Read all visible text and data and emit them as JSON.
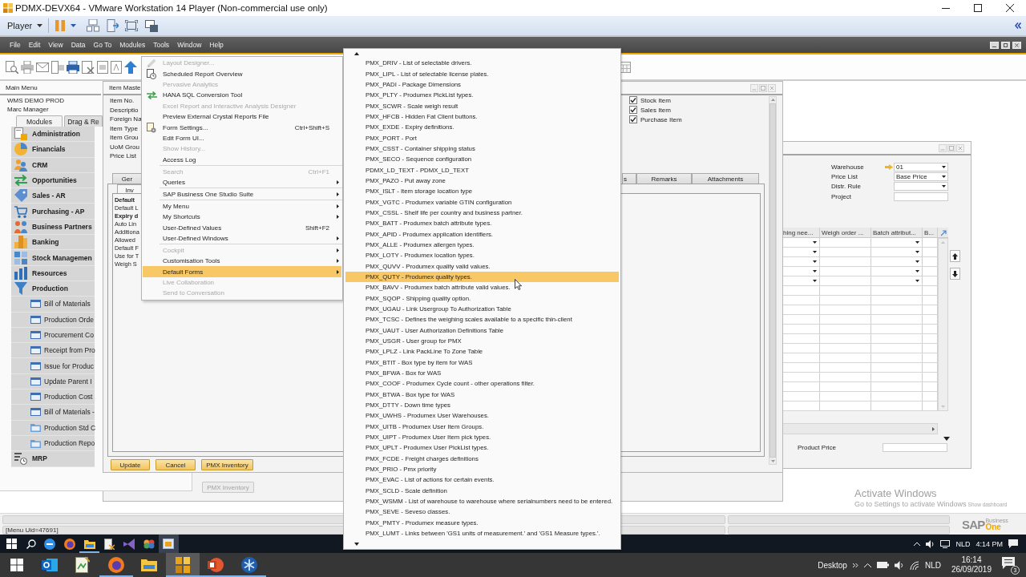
{
  "vm_window": {
    "title": "PDMX-DEVX64 - VMware Workstation 14 Player (Non-commercial use only)",
    "player_menu": "Player"
  },
  "menu_bar": [
    "File",
    "Edit",
    "View",
    "Data",
    "Go To",
    "Modules",
    "Tools",
    "Window",
    "Help"
  ],
  "tools_menu": {
    "groups": [
      [
        {
          "label": "Layout Designer...",
          "disabled": true,
          "submenu": false,
          "selected": false
        },
        {
          "label": "Scheduled Report Overview",
          "disabled": false,
          "submenu": false,
          "selected": false
        },
        {
          "label": "Pervasive Analytics",
          "disabled": true,
          "submenu": false,
          "selected": false
        },
        {
          "label": "HANA SQL Conversion Tool",
          "disabled": false,
          "submenu": false,
          "selected": false
        },
        {
          "label": "Excel Report and Interactive Analysis Designer",
          "disabled": true,
          "submenu": false,
          "selected": false
        },
        {
          "label": "Preview External Crystal Reports File",
          "disabled": false,
          "submenu": false,
          "selected": false
        },
        {
          "label": "Form Settings...",
          "shortcut": "Ctrl+Shift+S",
          "disabled": false,
          "submenu": false,
          "selected": false
        },
        {
          "label": "Edit Form UI...",
          "disabled": false,
          "submenu": false,
          "selected": false
        },
        {
          "label": "Show History...",
          "disabled": true,
          "submenu": false,
          "selected": false
        },
        {
          "label": "Access Log",
          "disabled": false,
          "submenu": false,
          "selected": false
        }
      ],
      [
        {
          "label": "Search",
          "shortcut": "Ctrl+F1",
          "disabled": true,
          "submenu": false,
          "selected": false
        },
        {
          "label": "Queries",
          "disabled": false,
          "submenu": true,
          "selected": false
        }
      ],
      [
        {
          "label": "SAP Business One Studio Suite",
          "disabled": false,
          "submenu": true,
          "selected": false
        }
      ],
      [
        {
          "label": "My Menu",
          "disabled": false,
          "submenu": true,
          "selected": false
        },
        {
          "label": "My Shortcuts",
          "disabled": false,
          "submenu": true,
          "selected": false
        },
        {
          "label": "User-Defined Values",
          "shortcut": "Shift+F2",
          "disabled": false,
          "submenu": false,
          "selected": false
        },
        {
          "label": "User-Defined Windows",
          "disabled": false,
          "submenu": true,
          "selected": false
        }
      ],
      [
        {
          "label": "Cockpit",
          "disabled": true,
          "submenu": true,
          "selected": false
        },
        {
          "label": "Customisation Tools",
          "disabled": false,
          "submenu": true,
          "selected": false
        },
        {
          "label": "Default Forms",
          "disabled": false,
          "submenu": true,
          "selected": true
        },
        {
          "label": "Live Collaboration",
          "disabled": true,
          "submenu": false,
          "selected": false
        },
        {
          "label": "Send to Conversation",
          "disabled": true,
          "submenu": false,
          "selected": false
        }
      ]
    ]
  },
  "default_forms_menu": {
    "items": [
      {
        "label": "PMX_DRIV - List of selectable drivers.",
        "selected": false
      },
      {
        "label": "PMX_LIPL - List of selectable license plates.",
        "selected": false
      },
      {
        "label": "PMX_PADI - Package Dimensions",
        "selected": false
      },
      {
        "label": "PMX_PLTY - Produmex PickList types.",
        "selected": false
      },
      {
        "label": "PMX_SCWR - Scale weigh result",
        "selected": false
      },
      {
        "label": "PMX_HFCB - Hidden Fat Client buttons.",
        "selected": false
      },
      {
        "label": "PMX_EXDE - Expiry definitions.",
        "selected": false
      },
      {
        "label": "PMX_PORT - Port",
        "selected": false
      },
      {
        "label": "PMX_CSST - Container shipping status",
        "selected": false
      },
      {
        "label": "PMX_SECO - Sequence configuration",
        "selected": false
      },
      {
        "label": "PDMX_LD_TEXT - PDMX_LD_TEXT",
        "selected": false
      },
      {
        "label": "PMX_PAZO - Put away zone",
        "selected": false
      },
      {
        "label": "PMX_ISLT - Item storage location type",
        "selected": false
      },
      {
        "label": "PMX_VGTC - Produmex variable GTIN configuration",
        "selected": false
      },
      {
        "label": "PMX_CSSL - Shelf life per country and business partner.",
        "selected": false
      },
      {
        "label": "PMX_BATT - Produmex batch attribute types.",
        "selected": false
      },
      {
        "label": "PMX_APID - Produmex application identifiers.",
        "selected": false
      },
      {
        "label": "PMX_ALLE - Produmex allergen types.",
        "selected": false
      },
      {
        "label": "PMX_LOTY - Produmex location types.",
        "selected": false
      },
      {
        "label": "PMX_QUVV - Produmex quality valid values.",
        "selected": false
      },
      {
        "label": "PMX_QUTY - Produmex quality types.",
        "selected": true
      },
      {
        "label": "PMX_BAVV - Produmex batch attribute valid values.",
        "selected": false
      },
      {
        "label": "PMX_SQOP - Shipping quality option.",
        "selected": false
      },
      {
        "label": "PMX_UGAU - Link Usergroup To Authorization Table",
        "selected": false
      },
      {
        "label": "PMX_TCSC - Defines the weighing scales available to a specific thin-client",
        "selected": false
      },
      {
        "label": "PMX_UAUT - User Authorization Definitions Table",
        "selected": false
      },
      {
        "label": "PMX_USGR - User group for PMX",
        "selected": false
      },
      {
        "label": "PMX_LPLZ - Link PackLine To Zone Table",
        "selected": false
      },
      {
        "label": "PMX_BTIT - Box type by item for WAS",
        "selected": false
      },
      {
        "label": "PMX_BFWA - Box for WAS",
        "selected": false
      },
      {
        "label": "PMX_COOF - Produmex Cycle count - other operations filter.",
        "selected": false
      },
      {
        "label": "PMX_BTWA - Box type for WAS",
        "selected": false
      },
      {
        "label": "PMX_DTTY - Down time types",
        "selected": false
      },
      {
        "label": "PMX_UWHS - Produmex User Warehouses.",
        "selected": false
      },
      {
        "label": "PMX_UITB - Produmex User Item Groups.",
        "selected": false
      },
      {
        "label": "PMX_UIPT - Produmex User Item pick types.",
        "selected": false
      },
      {
        "label": "PMX_UPLT - Produmex User PickList types.",
        "selected": false
      },
      {
        "label": "PMX_FCDE - Freight charges definitions",
        "selected": false
      },
      {
        "label": "PMX_PRIO - Pmx priority",
        "selected": false
      },
      {
        "label": "PMX_EVAC - List of actions for certain events.",
        "selected": false
      },
      {
        "label": "PMX_SCLD - Scale definition",
        "selected": false
      },
      {
        "label": "PMX_WSMM - List of warehouse to warehouse where serialnumbers need to be entered.",
        "selected": false
      },
      {
        "label": "PMX_SEVE - Seveso classes.",
        "selected": false
      },
      {
        "label": "PMX_PMTY - Produmex measure types.",
        "selected": false
      },
      {
        "label": "PMX_LUMT - Links between 'GS1 units of measurement.' and 'GS1 Measure types.'.",
        "selected": false
      }
    ]
  },
  "main_menu": {
    "title": "Main Menu",
    "company": "WMS DEMO PROD",
    "user": "Marc Manager",
    "tabs": [
      {
        "label": "Modules",
        "selected": true
      },
      {
        "label": "Drag & Re",
        "selected": false
      }
    ],
    "modules": [
      {
        "label": "Administration"
      },
      {
        "label": "Financials"
      },
      {
        "label": "CRM"
      },
      {
        "label": "Opportunities"
      },
      {
        "label": "Sales - AR"
      },
      {
        "label": "Purchasing - AP"
      },
      {
        "label": "Business Partners"
      },
      {
        "label": "Banking"
      },
      {
        "label": "Stock Managemen"
      },
      {
        "label": "Resources"
      },
      {
        "label": "Production",
        "expanded": true,
        "children": [
          {
            "label": "Bill of Materials",
            "kind": "form"
          },
          {
            "label": "Production Orde",
            "kind": "form"
          },
          {
            "label": "Procurement Co",
            "kind": "form"
          },
          {
            "label": "Receipt from Pro",
            "kind": "form"
          },
          {
            "label": "Issue for Produc",
            "kind": "form"
          },
          {
            "label": "Update Parent I",
            "kind": "form"
          },
          {
            "label": "Production Cost",
            "kind": "form"
          },
          {
            "label": "Bill of Materials -",
            "kind": "form"
          },
          {
            "label": "Production Std C",
            "kind": "report"
          },
          {
            "label": "Production Repo",
            "kind": "report"
          }
        ]
      },
      {
        "label": "MRP"
      }
    ]
  },
  "item_master": {
    "title": "Item Maste",
    "fields": [
      "Item No.",
      "Descriptio",
      "Foreign Na",
      "Item Type",
      "Item Grou",
      "UoM Grou",
      "Price List"
    ],
    "checkboxes": [
      {
        "label": "Stock Item",
        "checked": true
      },
      {
        "label": "Sales Item",
        "checked": true
      },
      {
        "label": "Purchase Item",
        "checked": true
      }
    ],
    "tabs": [
      {
        "label": "Ger",
        "selected": false
      },
      {
        "label": "s",
        "selected": false
      },
      {
        "label": "Remarks",
        "selected": false
      },
      {
        "label": "Attachments",
        "selected": false
      }
    ],
    "subtabs": [
      {
        "label": "Inv",
        "selected": true
      }
    ],
    "lines": [
      {
        "text": "Default",
        "kind": "heading"
      },
      {
        "text": "Default L",
        "kind": "field"
      },
      {
        "text": "Expiry d",
        "kind": "heading"
      },
      {
        "text": "Auto Lin",
        "kind": "field"
      },
      {
        "text": "Additiona",
        "kind": "field"
      },
      {
        "text": "Allowed",
        "kind": "field"
      },
      {
        "text": "Default F",
        "kind": "field"
      },
      {
        "text": "Use for T",
        "kind": "field"
      },
      {
        "text": "Weigh S",
        "kind": "field"
      }
    ],
    "buttons": [
      {
        "label": "Update",
        "disabled": false
      },
      {
        "label": "Cancel",
        "disabled": false
      },
      {
        "label": "PMX Inventory",
        "disabled": false
      }
    ]
  },
  "item_master_behind": {
    "buttons": [
      {
        "label": "PMX Inventory",
        "disabled": true
      }
    ]
  },
  "warehouse_form": {
    "fields": [
      {
        "label": "Warehouse",
        "value": "01",
        "kind": "dropdown",
        "linked": true
      },
      {
        "label": "Price List",
        "value": "Base Price",
        "kind": "dropdown",
        "linked": false
      },
      {
        "label": "Distr. Rule",
        "kind": "dropdown",
        "linked": false
      },
      {
        "label": "Project",
        "kind": "text",
        "linked": false
      }
    ],
    "grid": {
      "columns": [
        "hing nee...",
        "Weigh order ...",
        "Batch attribut...",
        "B..."
      ],
      "rows": [
        {
          "kind": "dropdown"
        },
        {
          "kind": "dropdown"
        },
        {
          "kind": "dropdown"
        },
        {
          "kind": "dropdown"
        },
        {
          "kind": "dropdown"
        },
        {
          "kind": "blank"
        },
        {
          "kind": "blank"
        },
        {
          "kind": "blank"
        },
        {
          "kind": "blank"
        },
        {
          "kind": "blank"
        },
        {
          "kind": "blank"
        },
        {
          "kind": "blank"
        },
        {
          "kind": "blank"
        },
        {
          "kind": "blank"
        },
        {
          "kind": "blank"
        },
        {
          "kind": "blank"
        },
        {
          "kind": "blank"
        },
        {
          "kind": "blank"
        }
      ]
    },
    "product_price_label": "Product Price"
  },
  "activation_notice": {
    "title": "Activate Windows",
    "text": "Go to Settings to activate Windows",
    "link": "Show dashboard"
  },
  "status_bar": {
    "message": "[Menu Uid=47691]",
    "logo": {
      "brand": "SAP",
      "line_1": "Business",
      "line_2": "One"
    }
  },
  "vm_taskbar": {
    "apps": [
      {
        "selected": false,
        "running": false
      },
      {
        "selected": false,
        "running": false
      },
      {
        "selected": false,
        "running": true
      },
      {
        "selected": false,
        "running": false
      },
      {
        "selected": false,
        "running": false
      },
      {
        "selected": false,
        "running": false
      },
      {
        "selected": true,
        "running": false
      }
    ],
    "tray": {
      "language": "NLD",
      "time": "4:14 PM"
    }
  },
  "host_taskbar": {
    "apps": [
      {
        "selected": false,
        "running": false
      },
      {
        "selected": false,
        "running": false
      },
      {
        "selected": false,
        "running": true
      },
      {
        "selected": false,
        "running": false
      },
      {
        "selected": true,
        "running": true
      },
      {
        "selected": false,
        "running": true
      },
      {
        "selected": false,
        "running": true
      }
    ],
    "toolbar_label": "Desktop",
    "tray": {
      "language": "NLD",
      "time": "16:14",
      "date": "26/09/2019",
      "notification_count": "3"
    }
  }
}
